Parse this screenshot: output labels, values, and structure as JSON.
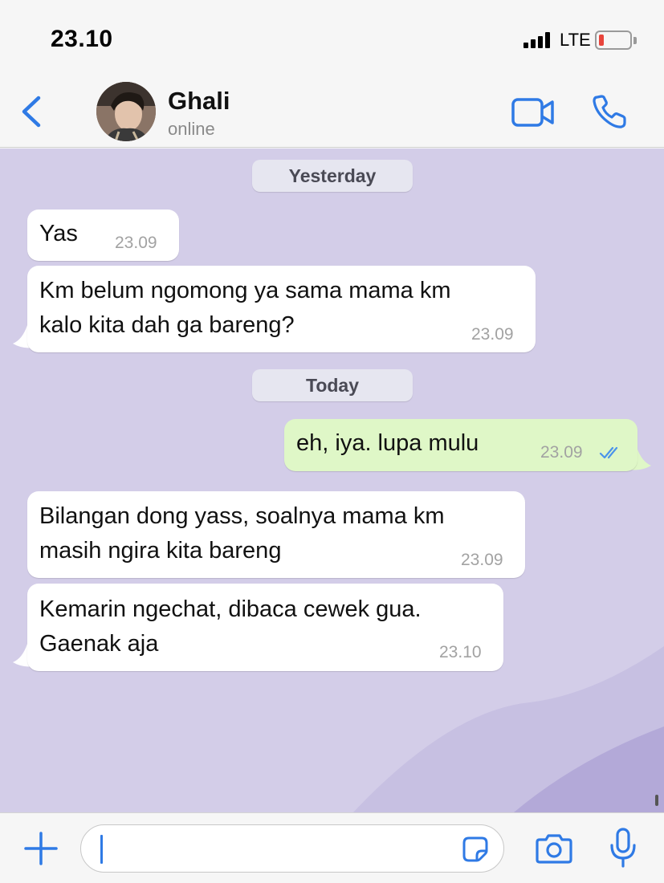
{
  "status_bar": {
    "time": "23.10",
    "network": "LTE",
    "battery_level": 0.15,
    "battery_color": "#e8453c"
  },
  "header": {
    "back_icon": "chevron-left-icon",
    "contact_name": "Ghali",
    "contact_status": "online",
    "video_icon": "video-camera-icon",
    "call_icon": "phone-icon",
    "accent_color": "#2f7ae5"
  },
  "chat": {
    "background_color": "#d3cde8",
    "date_separators": [
      "Yesterday",
      "Today"
    ],
    "messages": [
      {
        "direction": "incoming",
        "text": "Yas",
        "time": "23.09"
      },
      {
        "direction": "incoming",
        "text": "Km belum ngomong ya sama mama km\nkalo kita dah ga bareng?",
        "time": "23.09"
      },
      {
        "direction": "outgoing",
        "text": "eh, iya. lupa mulu",
        "time": "23.09",
        "status": "read"
      },
      {
        "direction": "incoming",
        "text": "Bilangan dong yass, soalnya mama km\nmasih ngira kita bareng",
        "time": "23.09"
      },
      {
        "direction": "incoming",
        "text": "Kemarin ngechat, dibaca cewek gua.\nGaenak aja",
        "time": "23.10"
      }
    ]
  },
  "input_bar": {
    "plus_icon": "plus-icon",
    "message_value": "",
    "sticker_icon": "sticker-icon",
    "camera_icon": "camera-icon",
    "mic_icon": "microphone-icon"
  }
}
